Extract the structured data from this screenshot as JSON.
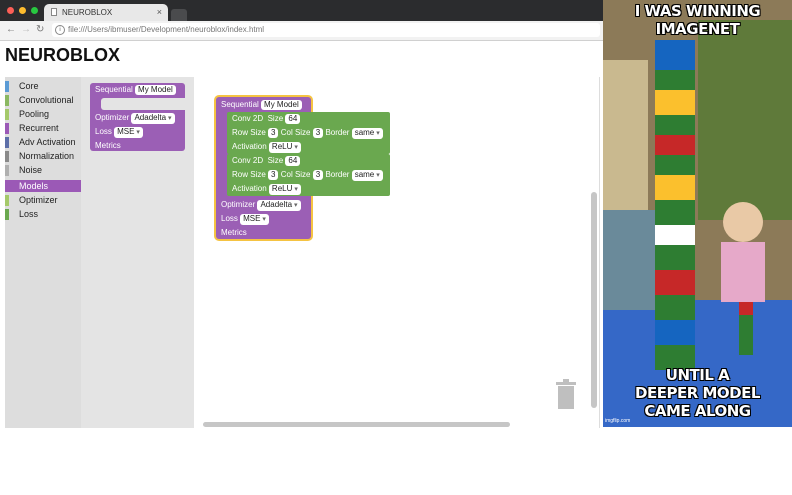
{
  "browser": {
    "tab_title": "NEUROBLOX",
    "tab_close": "×",
    "url": "file:///Users/ibmuser/Development/neuroblox/index.html",
    "back_icon": "arrow-left-icon",
    "forward_icon": "arrow-right-icon",
    "reload_icon": "reload-icon"
  },
  "page": {
    "title": "NEUROBLOX"
  },
  "sidebar": {
    "items": [
      {
        "label": "Core",
        "color": "#5b9bd5"
      },
      {
        "label": "Convolutional",
        "color": "#8bb862"
      },
      {
        "label": "Pooling",
        "color": "#a5c96a"
      },
      {
        "label": "Recurrent",
        "color": "#9b59b6"
      },
      {
        "label": "Adv Activation",
        "color": "#5d6fa8"
      },
      {
        "label": "Normalization",
        "color": "#8a8a8a"
      },
      {
        "label": "Noise",
        "color": "#b0b0b0"
      },
      {
        "label": "Models",
        "color": "#9b59b6",
        "selected": true
      },
      {
        "label": "Optimizer",
        "color": "#a5c96a"
      },
      {
        "label": "Loss",
        "color": "#6aa84f"
      }
    ]
  },
  "flyout_block": {
    "header": "Sequential",
    "name": "My Model",
    "optimizer_label": "Optimizer",
    "optimizer_value": "Adadelta",
    "loss_label": "Loss",
    "loss_value": "MSE",
    "metrics_label": "Metrics"
  },
  "model_block": {
    "header": "Sequential",
    "name": "My Model",
    "layers": [
      {
        "type": "Conv 2D",
        "size_label": "Size",
        "size": "64",
        "row_label": "Row Size",
        "row": "3",
        "col_label": "Col Size",
        "col": "3",
        "border_label": "Border",
        "border": "same",
        "activation_label": "Activation",
        "activation": "ReLU"
      },
      {
        "type": "Conv 2D",
        "size_label": "Size",
        "size": "64",
        "row_label": "Row Size",
        "row": "3",
        "col_label": "Col Size",
        "col": "3",
        "border_label": "Border",
        "border": "same",
        "activation_label": "Activation",
        "activation": "ReLU"
      }
    ],
    "optimizer_label": "Optimizer",
    "optimizer_value": "Adadelta",
    "loss_label": "Loss",
    "loss_value": "MSE",
    "metrics_label": "Metrics"
  },
  "trash_icon": "trash-icon",
  "meme": {
    "top_line1": "I WAS WINNING",
    "top_line2": "IMAGENET",
    "bottom_line1": "UNTIL A",
    "bottom_line2": "DEEPER MODEL",
    "bottom_line3": "CAME ALONG",
    "credit": "imgflip.com"
  }
}
